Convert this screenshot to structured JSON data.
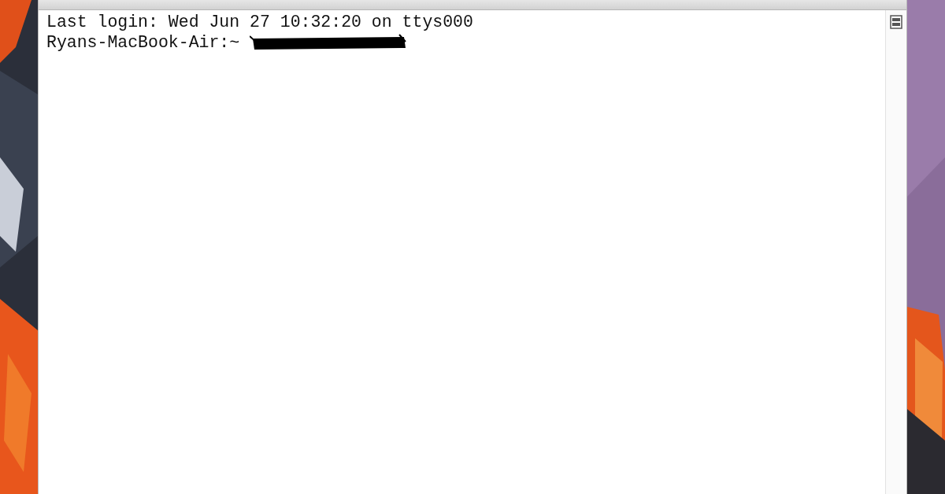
{
  "terminal": {
    "lines": [
      "Last login: Wed Jun 27 10:32:20 on ttys000",
      "Ryans-MacBook-Air:~ "
    ]
  }
}
